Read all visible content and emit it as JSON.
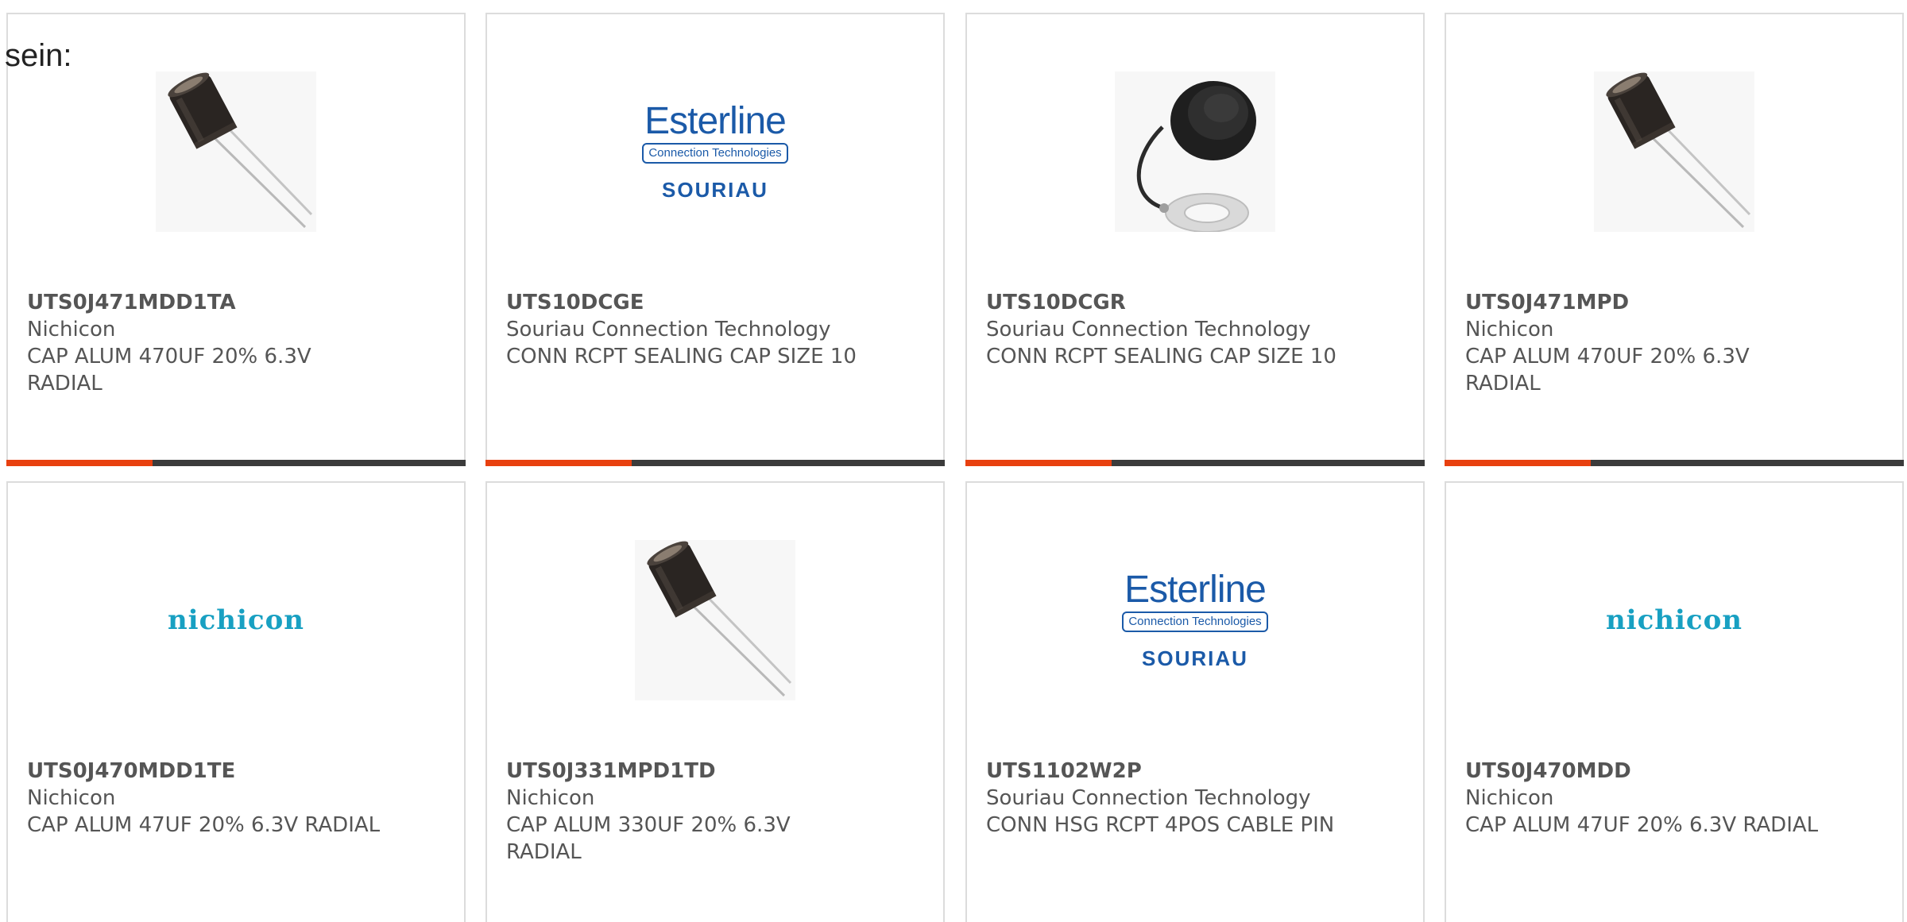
{
  "intro_text": "sein:",
  "colors": {
    "accent": "#e8400f",
    "bar": "#3b3b3b",
    "border": "#dcdcdc",
    "text": "#555555",
    "nichicon_brand": "#18a0c2",
    "esterline_brand": "#1b5aa8"
  },
  "logos": {
    "nichicon": "nichicon",
    "esterline": "Esterline",
    "esterline_sub": "Connection Technologies",
    "souriau": "SOURIAU"
  },
  "products": [
    {
      "part_number": "UTS0J471MDD1TA",
      "manufacturer": "Nichicon",
      "description": "CAP ALUM 470UF 20% 6.3V RADIAL",
      "image": "capacitor-photo"
    },
    {
      "part_number": "UTS10DCGE",
      "manufacturer": "Souriau Connection Technology",
      "description": "CONN RCPT SEALING CAP SIZE 10",
      "image": "esterline-souriau-logo"
    },
    {
      "part_number": "UTS10DCGR",
      "manufacturer": "Souriau Connection Technology",
      "description": "CONN RCPT SEALING CAP SIZE 10",
      "image": "sealing-cap-photo"
    },
    {
      "part_number": "UTS0J471MPD",
      "manufacturer": "Nichicon",
      "description": "CAP ALUM 470UF 20% 6.3V RADIAL",
      "image": "capacitor-photo"
    },
    {
      "part_number": "UTS0J470MDD1TE",
      "manufacturer": "Nichicon",
      "description": "CAP ALUM 47UF 20% 6.3V RADIAL",
      "image": "nichicon-logo"
    },
    {
      "part_number": "UTS0J331MPD1TD",
      "manufacturer": "Nichicon",
      "description": "CAP ALUM 330UF 20% 6.3V RADIAL",
      "image": "capacitor-photo"
    },
    {
      "part_number": "UTS1102W2P",
      "manufacturer": "Souriau Connection Technology",
      "description": "CONN HSG RCPT 4POS CABLE PIN",
      "image": "esterline-souriau-logo"
    },
    {
      "part_number": "UTS0J470MDD",
      "manufacturer": "Nichicon",
      "description": "CAP ALUM 47UF 20% 6.3V RADIAL",
      "image": "nichicon-logo"
    }
  ]
}
